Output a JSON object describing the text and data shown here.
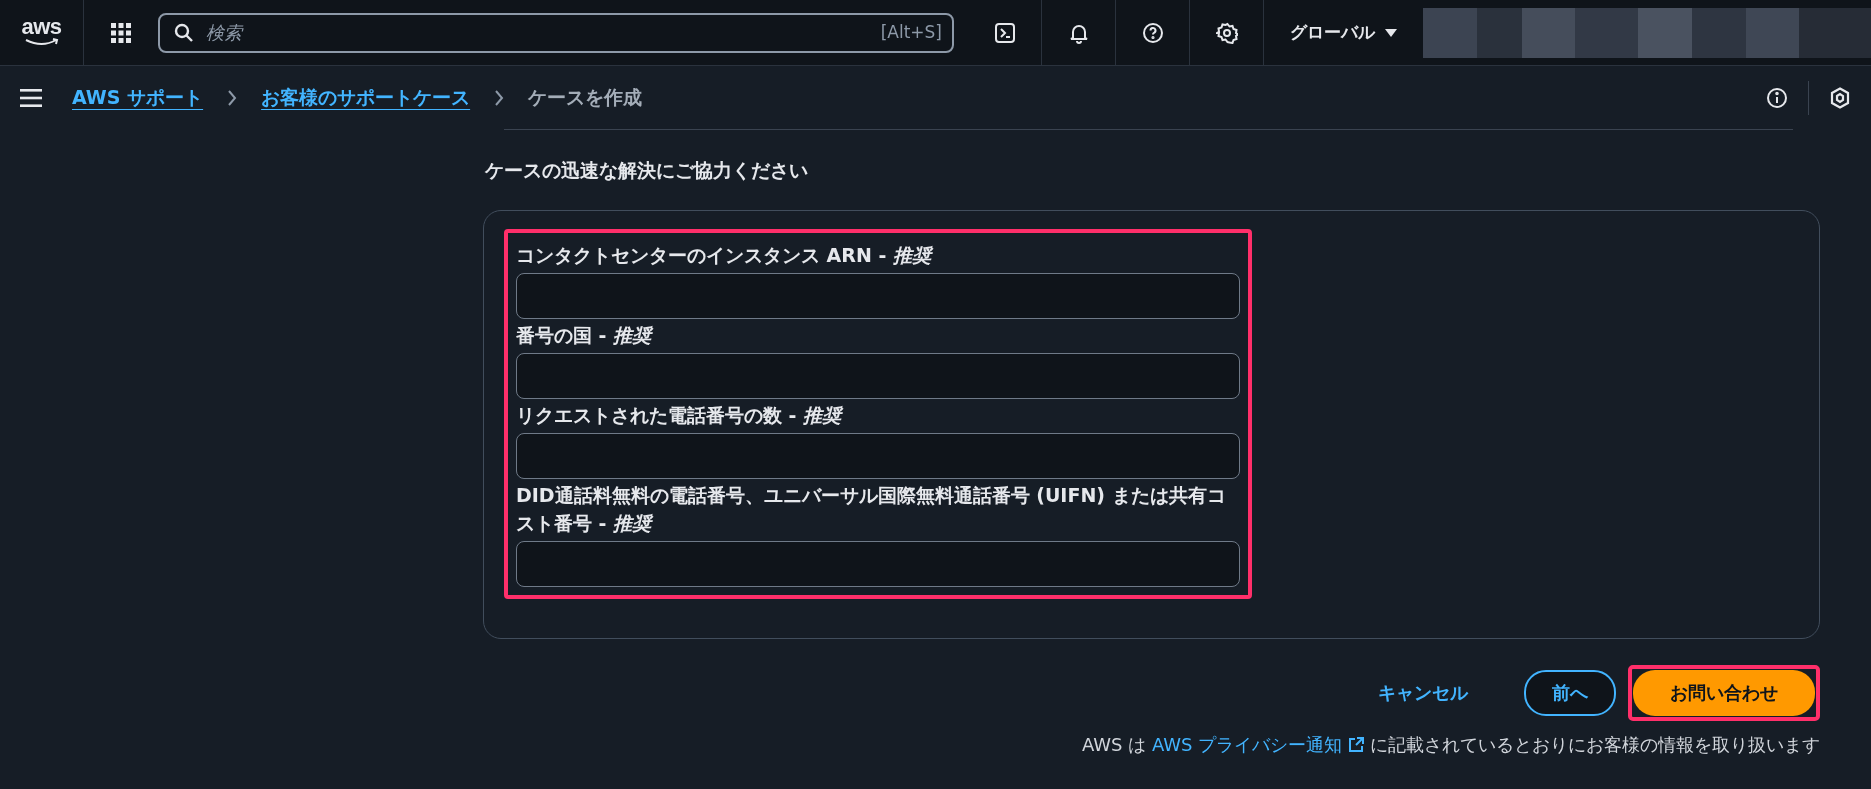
{
  "top_bar": {
    "logo": "aws",
    "search": {
      "placeholder": "検索",
      "shortcut": "[Alt+S]"
    },
    "region": "グローバル"
  },
  "breadcrumbs": [
    {
      "label": "AWS サポート",
      "link": true
    },
    {
      "label": "お客様のサポートケース",
      "link": true
    },
    {
      "label": "ケースを作成",
      "link": false
    }
  ],
  "heading": "ケースの迅速な解決にご協力ください",
  "fields_highlighted": true,
  "fields": [
    {
      "label": "コンタクトセンターのインスタンス ARN - *推奨*"
    },
    {
      "label": "番号の国 - *推奨*"
    },
    {
      "label": "リクエストされた電話番号の数 - *推奨*"
    },
    {
      "label": "DID通話料無料の電話番号、ユニバーサル国際無料通話番号 (UIFN) または共有コスト番号 - *推奨*"
    }
  ],
  "actions": {
    "cancel": "キャンセル",
    "previous": "前へ",
    "submit": "お問い合わせ",
    "submit_highlighted": true
  },
  "footer": {
    "prefix": "AWS は",
    "link": "AWS プライバシー通知",
    "suffix": "に記載されているとおりにお客様の情報を取り扱います"
  }
}
